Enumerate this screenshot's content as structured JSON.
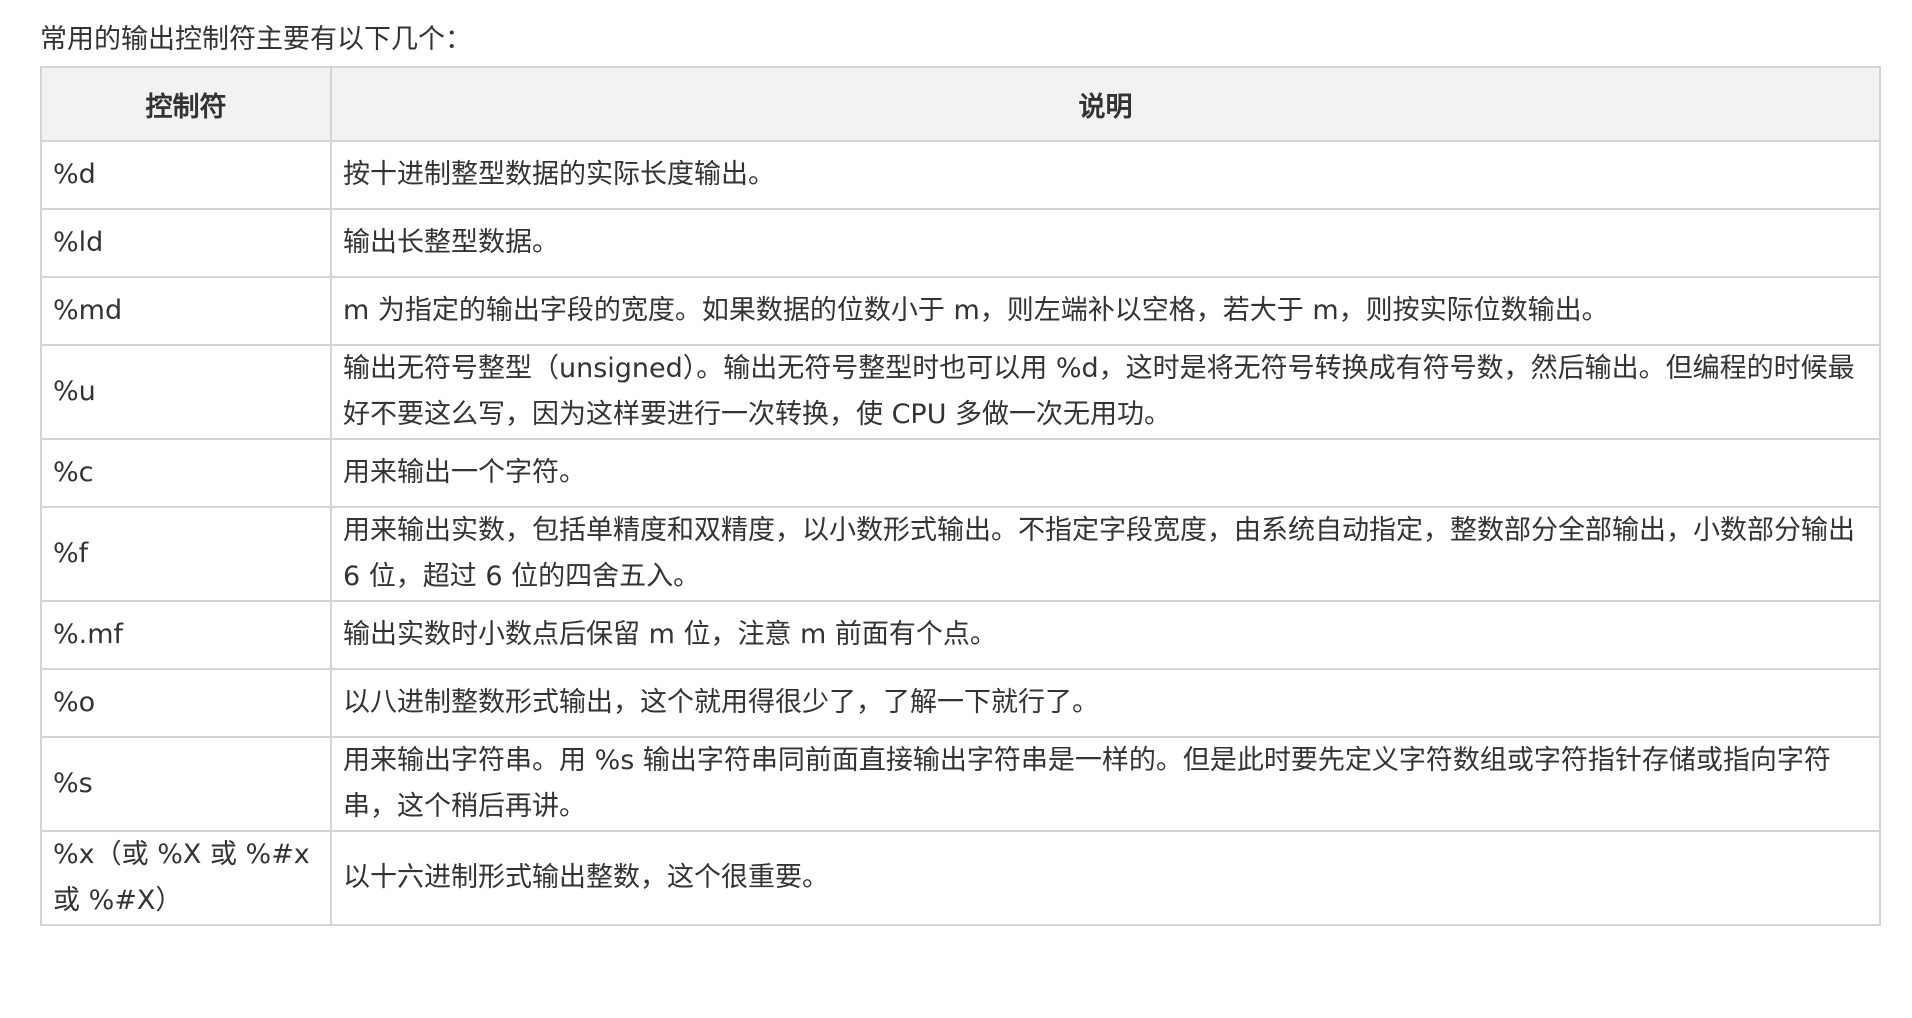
{
  "intro": "常用的输出控制符主要有以下几个：",
  "table": {
    "headers": [
      "控制符",
      "说明"
    ],
    "rows": [
      {
        "code": "%d",
        "desc": "按十进制整型数据的实际长度输出。"
      },
      {
        "code": "%ld",
        "desc": "输出长整型数据。"
      },
      {
        "code": "%md",
        "desc": "m 为指定的输出字段的宽度。如果数据的位数小于 m，则左端补以空格，若大于 m，则按实际位数输出。"
      },
      {
        "code": "%u",
        "desc": "输出无符号整型（unsigned）。输出无符号整型时也可以用 %d，这时是将无符号转换成有符号数，然后输出。但编程的时候最好不要这么写，因为这样要进行一次转换，使 CPU 多做一次无用功。"
      },
      {
        "code": "%c",
        "desc": "用来输出一个字符。"
      },
      {
        "code": "%f",
        "desc": "用来输出实数，包括单精度和双精度，以小数形式输出。不指定字段宽度，由系统自动指定，整数部分全部输出，小数部分输出 6 位，超过 6 位的四舍五入。"
      },
      {
        "code": "%.mf",
        "desc": "输出实数时小数点后保留 m 位，注意 m 前面有个点。"
      },
      {
        "code": "%o",
        "desc": "以八进制整数形式输出，这个就用得很少了，了解一下就行了。"
      },
      {
        "code": "%s",
        "desc": "用来输出字符串。用 %s 输出字符串同前面直接输出字符串是一样的。但是此时要先定义字符数组或字符指针存储或指向字符串，这个稍后再讲。"
      },
      {
        "code": "%x（或 %X 或 %#x 或 %#X）",
        "desc": "以十六进制形式输出整数，这个很重要。"
      }
    ]
  }
}
